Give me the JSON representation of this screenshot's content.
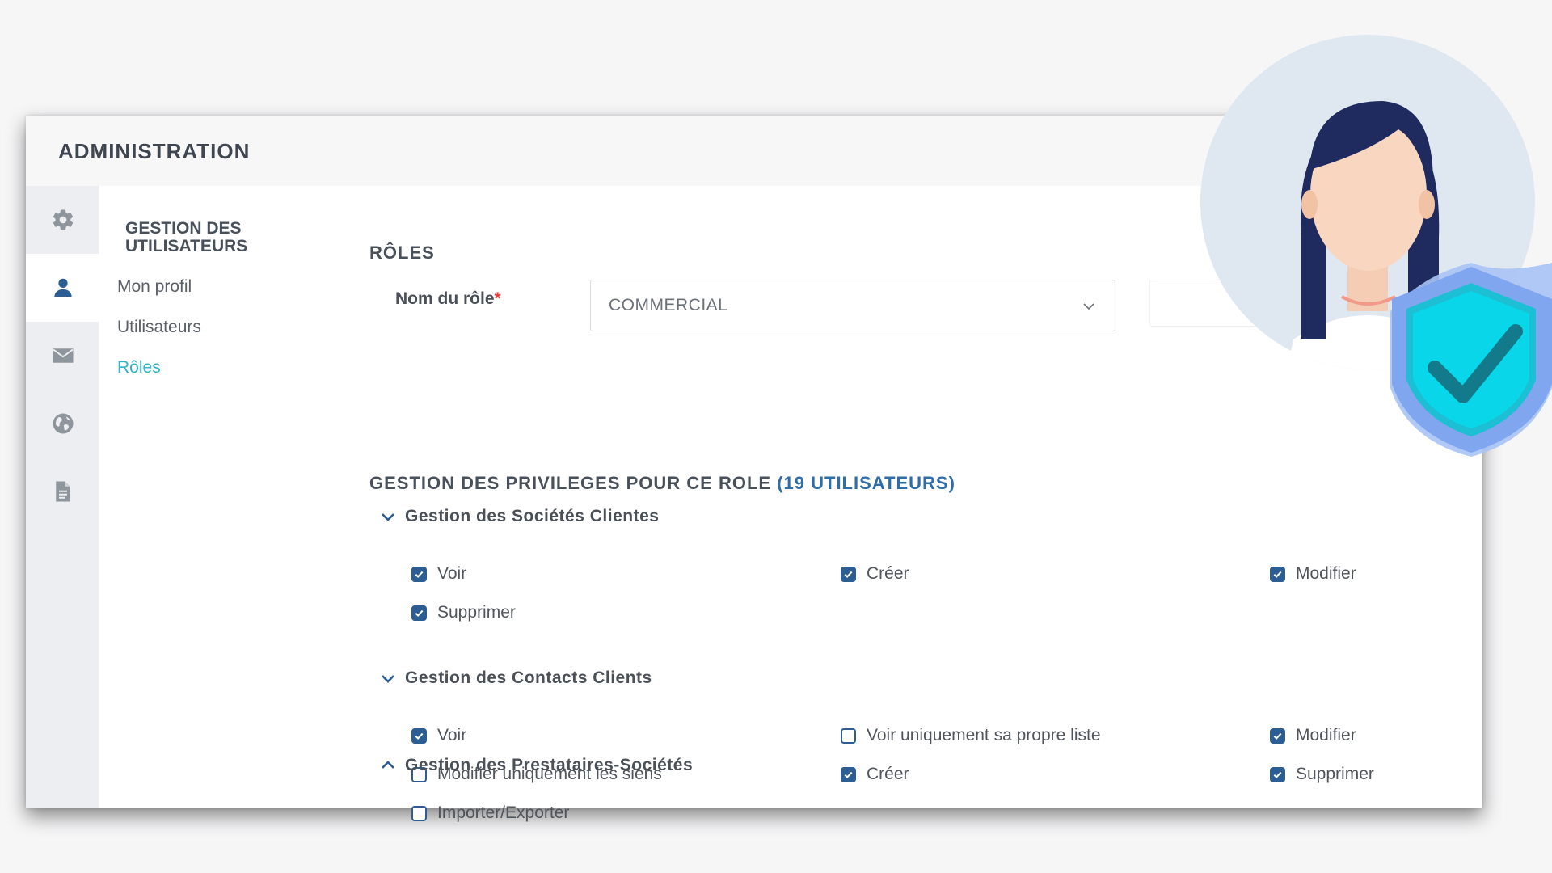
{
  "header": {
    "title": "ADMINISTRATION"
  },
  "rail": {
    "items": [
      {
        "icon": "gear-icon"
      },
      {
        "icon": "user-icon",
        "active": true
      },
      {
        "icon": "envelope-icon"
      },
      {
        "icon": "globe-icon"
      },
      {
        "icon": "document-icon"
      }
    ]
  },
  "subnav": {
    "title": "GESTION DES UTILISATEURS",
    "items": [
      {
        "label": "Mon profil"
      },
      {
        "label": "Utilisateurs"
      },
      {
        "label": "Rôles",
        "active": true
      }
    ]
  },
  "roles": {
    "section_title": "RÔLES",
    "role_name_label": "Nom du rôle",
    "required_mark": "*",
    "role_name_value": "COMMERCIAL"
  },
  "privileges": {
    "title": "GESTION DES PRIVILEGES POUR CE ROLE",
    "user_count": "(19 UTILISATEURS)",
    "groups": [
      {
        "name": "Gestion des Sociétés Clientes",
        "expanded": true,
        "items": [
          {
            "label": "Voir",
            "checked": true
          },
          {
            "label": "Créer",
            "checked": true
          },
          {
            "label": "Modifier",
            "checked": true
          },
          {
            "label": "Supprimer",
            "checked": true
          }
        ]
      },
      {
        "name": "Gestion des Contacts Clients",
        "expanded": true,
        "items": [
          {
            "label": "Voir",
            "checked": true
          },
          {
            "label": "Voir uniquement sa propre liste",
            "checked": false
          },
          {
            "label": "Modifier",
            "checked": true
          },
          {
            "label": "Modifier uniquement les siens",
            "checked": false
          },
          {
            "label": "Créer",
            "checked": true
          },
          {
            "label": "Supprimer",
            "checked": true
          },
          {
            "label": "Importer/Exporter",
            "checked": false
          }
        ]
      },
      {
        "name": "Gestion des Prestataires-Sociétés",
        "expanded": false,
        "items": []
      }
    ]
  },
  "colors": {
    "accent": "#2fb3c6",
    "checkbox": "#2c5d93",
    "count": "#2e6da7",
    "required": "#e23c3c"
  },
  "illustration": {
    "icons": [
      "woman-avatar-icon",
      "shield-check-icon"
    ]
  }
}
